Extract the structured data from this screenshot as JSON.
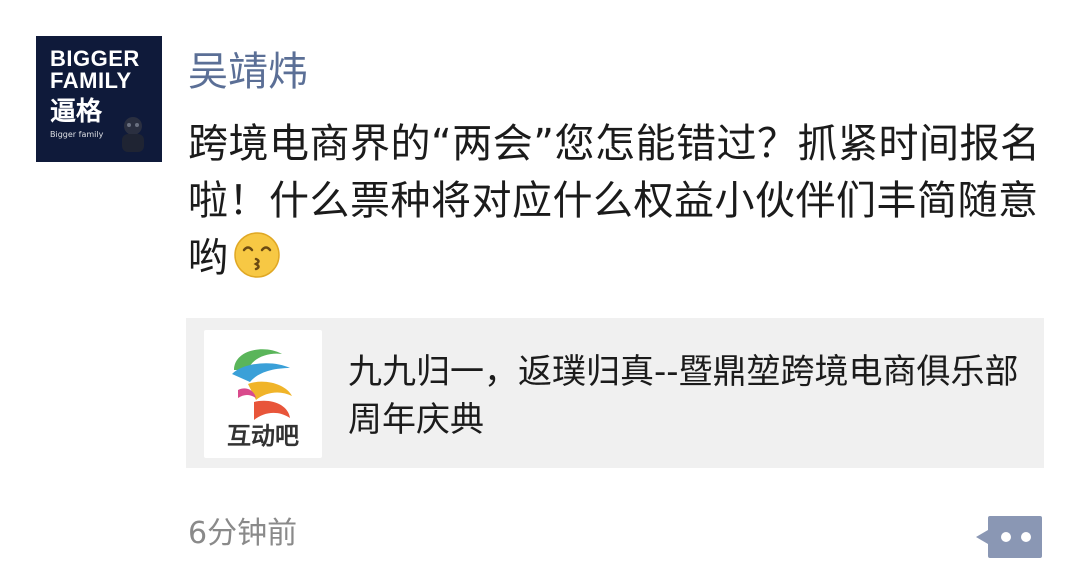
{
  "post": {
    "avatar": {
      "line1": "BIGGER",
      "line2": "FAMILY",
      "line3": "逼格",
      "line4": "Bigger family"
    },
    "username": "吴靖炜",
    "content": "跨境电商界的“两会”您怎能错过？抓紧时间报名啦！什么票种将对应什么权益小伙伴们丰简随意哟",
    "emoji": "kissing-face-icon",
    "link_card": {
      "thumb_label": "互动吧",
      "title": "九九归一，返璞归真--暨鼎堃跨境电商俱乐部周年庆典"
    },
    "timestamp": "6分钟前",
    "comment_icon": "comment-dots-icon"
  },
  "colors": {
    "username": "#5b6f96",
    "card_bg": "#f0f0f0",
    "avatar_bg": "#0f1a3a",
    "comment_button": "#8a97b4"
  }
}
